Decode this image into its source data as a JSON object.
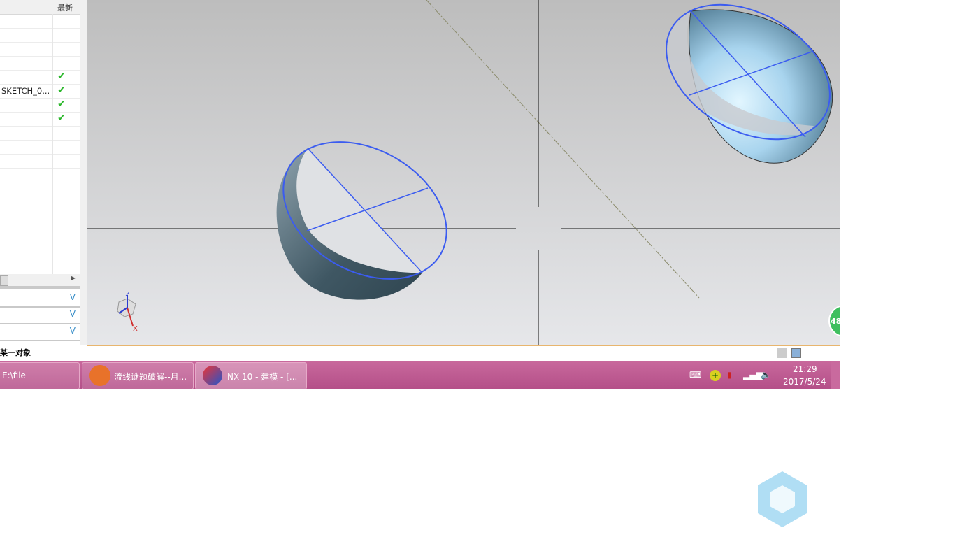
{
  "panel": {
    "header": "最新",
    "rows": [
      "",
      "",
      "",
      "",
      "",
      "SKETCH_0...",
      "",
      "",
      "",
      "",
      "",
      "",
      "",
      "",
      "",
      "",
      "",
      "",
      ""
    ],
    "checks": [
      false,
      false,
      false,
      false,
      true,
      true,
      true,
      true,
      false,
      false,
      false,
      false,
      false,
      false,
      false,
      false,
      false,
      false,
      false
    ]
  },
  "status": "某一对象",
  "viewport": {
    "badge": "48",
    "axes": {
      "z": "Z",
      "x": "X"
    }
  },
  "taskbar": {
    "start": "E:\\file",
    "items": [
      "流线谜题破解--月...",
      "NX 10 - 建模 - [..."
    ],
    "time": "21:29",
    "date": "2017/5/24"
  },
  "colors": {
    "taskbar": "#b44f88",
    "edge": "#3b5cf0"
  }
}
